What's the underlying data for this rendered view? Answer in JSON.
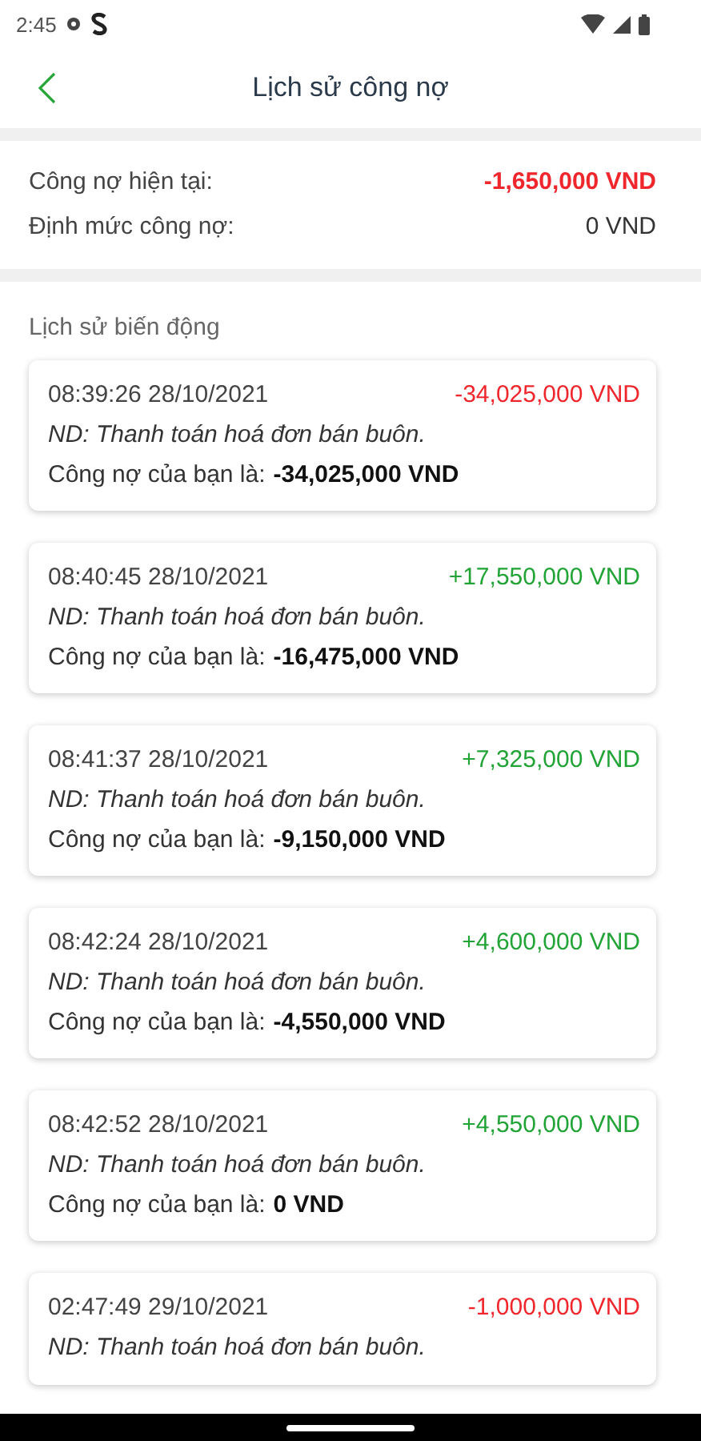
{
  "status_bar": {
    "time": "2:45"
  },
  "header": {
    "title": "Lịch sử công nợ"
  },
  "summary": [
    {
      "label": "Công nợ hiện tại:",
      "value": "-1,650,000 VND",
      "color": "#f0262d"
    },
    {
      "label": "Định mức công nợ:",
      "value": "0 VND",
      "color": "#333333"
    }
  ],
  "history": {
    "title": "Lịch sử biến động",
    "entries": [
      {
        "time": "08:39:26 28/10/2021",
        "amount": "-34,025,000 VND",
        "color": "#f0262d",
        "note": "ND: Thanh toán hoá đơn bán buôn.",
        "balance_label": "Công nợ của bạn là:",
        "balance": "-34,025,000 VND"
      },
      {
        "time": "08:40:45 28/10/2021",
        "amount": "+17,550,000 VND",
        "color": "#21a336",
        "note": "ND: Thanh toán hoá đơn bán buôn.",
        "balance_label": "Công nợ của bạn là:",
        "balance": "-16,475,000 VND"
      },
      {
        "time": "08:41:37 28/10/2021",
        "amount": "+7,325,000 VND",
        "color": "#21a336",
        "note": "ND: Thanh toán hoá đơn bán buôn.",
        "balance_label": "Công nợ của bạn là:",
        "balance": "-9,150,000 VND"
      },
      {
        "time": "08:42:24 28/10/2021",
        "amount": "+4,600,000 VND",
        "color": "#21a336",
        "note": "ND: Thanh toán hoá đơn bán buôn.",
        "balance_label": "Công nợ của bạn là:",
        "balance": "-4,550,000 VND"
      },
      {
        "time": "08:42:52 28/10/2021",
        "amount": "+4,550,000 VND",
        "color": "#21a336",
        "note": "ND: Thanh toán hoá đơn bán buôn.",
        "balance_label": "Công nợ của bạn là:",
        "balance": "0 VND"
      },
      {
        "time": "02:47:49 29/10/2021",
        "amount": "-1,000,000 VND",
        "color": "#f0262d",
        "note": "ND: Thanh toán hoá đơn bán buôn."
      }
    ]
  }
}
